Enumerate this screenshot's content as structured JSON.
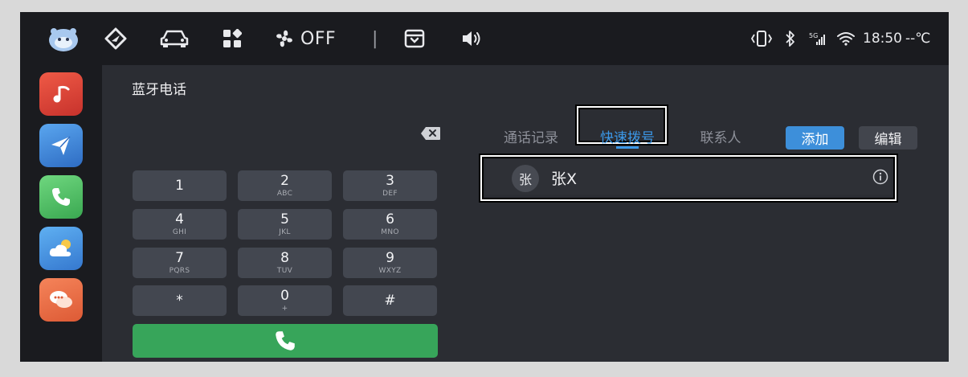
{
  "statusbar": {
    "fan_status": "OFF",
    "divider": "|",
    "signal_label": "5G",
    "time": "18:50",
    "temperature": "--℃"
  },
  "dock": {
    "apps": [
      {
        "name": "music",
        "color": "#d9423a"
      },
      {
        "name": "navigation",
        "color": "#3a7fd0"
      },
      {
        "name": "phone",
        "color": "#4fc266"
      },
      {
        "name": "weather",
        "color": "#3d8fda"
      },
      {
        "name": "messages",
        "color": "#e46a40"
      }
    ]
  },
  "panel": {
    "title": "蓝牙电话",
    "keypad": [
      {
        "num": "1",
        "sub": ""
      },
      {
        "num": "2",
        "sub": "ABC"
      },
      {
        "num": "3",
        "sub": "DEF"
      },
      {
        "num": "4",
        "sub": "GHI"
      },
      {
        "num": "5",
        "sub": "JKL"
      },
      {
        "num": "6",
        "sub": "MNO"
      },
      {
        "num": "7",
        "sub": "PQRS"
      },
      {
        "num": "8",
        "sub": "TUV"
      },
      {
        "num": "9",
        "sub": "WXYZ"
      },
      {
        "num": "*",
        "sub": ""
      },
      {
        "num": "0",
        "sub": "+"
      },
      {
        "num": "#",
        "sub": ""
      }
    ],
    "tabs": [
      {
        "label": "通话记录",
        "active": false
      },
      {
        "label": "快速拨号",
        "active": true
      },
      {
        "label": "联系人",
        "active": false
      }
    ],
    "add_label": "添加",
    "edit_label": "编辑",
    "contacts": [
      {
        "avatar": "张",
        "name": "张X"
      }
    ]
  },
  "colors": {
    "accent": "#3b98e8",
    "call_green": "#37a55a",
    "key_bg": "#434750"
  }
}
